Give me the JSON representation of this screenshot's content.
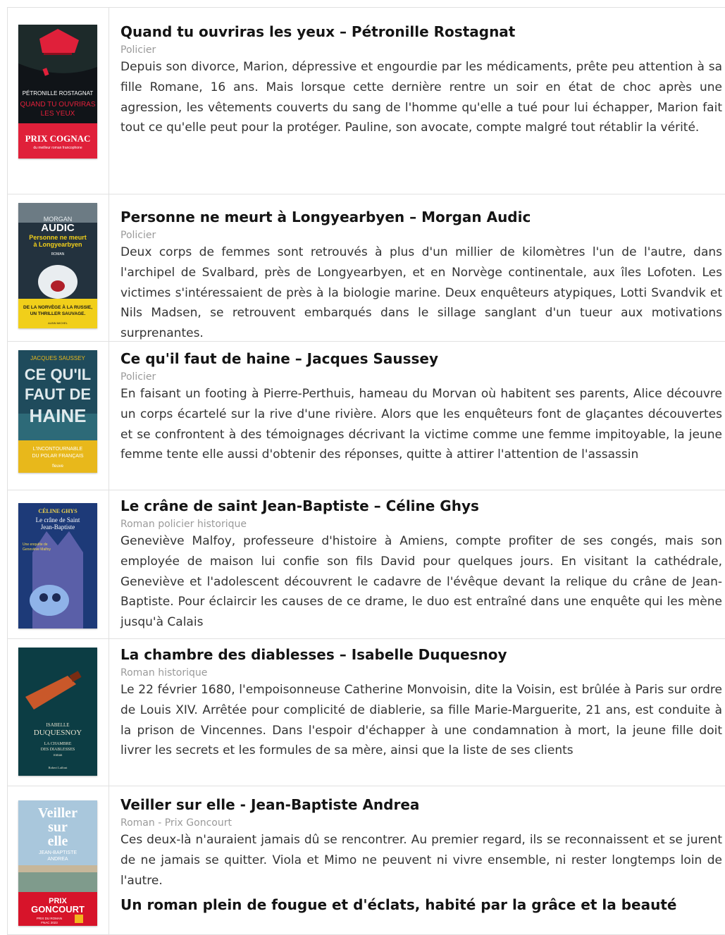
{
  "books": [
    {
      "title": "Quand tu ouvriras les yeux – Pétronille Rostagnat",
      "genre": "Policier",
      "description": "Depuis son divorce, Marion, dépressive et engourdie par les médicaments, prête peu attention à sa fille Romane, 16 ans. Mais lorsque cette dernière rentre un soir en état de choc après une agression, les vêtements couverts du sang de l'homme qu'elle a tué pour lui échapper, Marion fait tout ce qu'elle peut pour la protéger. Pauline, son avocate, compte malgré tout rétablir la vérité.",
      "cover": {
        "author": "PÉTRONILLE ROSTAGNAT",
        "title1": "QUAND TU OUVRIRAS",
        "title2": "LES YEUX",
        "prize": "PRIX COGNAC",
        "prize_sub": "du meilleur roman francophone",
        "colors": {
          "bg": "#101418",
          "accent": "#e0203a",
          "text": "#ffffff"
        }
      }
    },
    {
      "title": "Personne ne meurt à Longyearbyen  – Morgan Audic",
      "genre": "Policier",
      "description": "Deux corps de femmes sont retrouvés à plus d'un millier de kilomètres l'un de l'autre, dans l'archipel de Svalbard, près de Longyearbyen, et en Norvège continentale, aux îles Lofoten. Les victimes s'intéressaient de près à la biologie marine. Deux enquêteurs atypiques, Lotti Svandvik et Nils Madsen, se retrouvent embarqués dans le sillage sanglant d'un tueur aux motivations surprenantes.",
      "cover": {
        "author1": "MORGAN",
        "author2": "AUDIC",
        "title1": "Personne ne meurt",
        "title2": "à Longyearbyen",
        "kind": "ROMAN",
        "band1": "DE LA NORVÈGE À LA RUSSIE,",
        "band2": "UN THRILLER SAUVAGE.",
        "publisher": "ALBIN MICHEL",
        "colors": {
          "bg": "#23323e",
          "band": "#f1cf1a",
          "title": "#f1cf1a"
        }
      }
    },
    {
      "title": "Ce qu'il faut de haine – Jacques Saussey",
      "genre": "Policier",
      "description": "En faisant un footing à Pierre-Perthuis, hameau du Morvan où habitent ses parents, Alice découvre un corps écartelé sur la rive d'une rivière. Alors que les enquêteurs font de glaçantes découvertes et se confrontent à des témoignages décrivant la victime comme une femme impitoyable, la jeune femme tente elle aussi d'obtenir des réponses, quitte à attirer l'attention de l'assassin",
      "cover": {
        "author": "JACQUES SAUSSEY",
        "t1": "CE QU'IL",
        "t2": "FAUT DE",
        "t3": "HAINE",
        "band1": "L'INCONTOURNABLE",
        "band2": "DU POLAR FRANÇAIS",
        "publisher": "fleuve",
        "colors": {
          "bg": "#1f4b5c",
          "band": "#e8b81b"
        }
      }
    },
    {
      "title": "Le crâne de saint Jean-Baptiste – Céline Ghys",
      "genre": "Roman policier historique",
      "description": "Geneviève Malfoy, professeure d'histoire à Amiens, compte profiter de ses congés, mais son employée de maison lui confie son fils David pour quelques jours. En visitant la cathédrale, Geneviève et l'adolescent découvrent le cadavre de l'évêque devant la relique du crâne de Jean-Baptiste. Pour éclaircir les causes de ce drame, le duo est entraîné dans une enquête qui les mène jusqu'à Calais",
      "cover": {
        "author": "CÉLINE GHYS",
        "title1": "Le crâne de Saint",
        "title2": "Jean-Baptiste",
        "series1": "Une enquête de",
        "series2": "Geneviève Malfoy",
        "colors": {
          "bg": "#1d3a78",
          "text": "#f3d64b"
        }
      }
    },
    {
      "title": "La chambre des diablesses – Isabelle Duquesnoy",
      "genre": "Roman historique",
      "description": "Le 22 février 1680, l'empoisonneuse Catherine Monvoisin, dite la Voisin, est brûlée à Paris sur ordre de Louis XIV. Arrêtée pour complicité de diablerie, sa fille Marie-Marguerite, 21 ans, est conduite à la prison de Vincennes. Dans l'espoir d'échapper à une condamnation à mort, la jeune fille doit livrer les secrets et les formules de sa mère, ainsi que la liste de ses clients",
      "cover": {
        "author1": "ISABELLE",
        "author2": "DUQUESNOY",
        "title1": "LA CHAMBRE",
        "title2": "DES DIABLESSES",
        "kind": "roman",
        "publisher": "Robert Laffont",
        "colors": {
          "bg": "#0c3d44",
          "bottle": "#c9582a"
        }
      }
    },
    {
      "title": "Veiller sur elle - Jean-Baptiste Andrea",
      "genre": "Roman - Prix Goncourt",
      "description": "Ces deux-là n'auraient jamais dû se rencontrer. Au premier regard, ils se reconnaissent et se jurent de ne jamais se quitter. Viola et Mimo ne peuvent ni vivre ensemble, ni rester longtemps loin de l'autre.",
      "tagline": "Un roman plein de fougue et d'éclats, habité par la grâce et la beauté",
      "cover": {
        "t1": "Veiller",
        "t2": "sur",
        "t3": "elle",
        "author1": "JEAN-BAPTISTE",
        "author2": "ANDREA",
        "prize1": "PRIX",
        "prize2": "GONCOURT",
        "prize_sub": "PRIX DU ROMAN",
        "prize_sub2": "FNAC 2023",
        "colors": {
          "sky": "#a9c7dc",
          "band": "#d7142a"
        }
      }
    }
  ]
}
